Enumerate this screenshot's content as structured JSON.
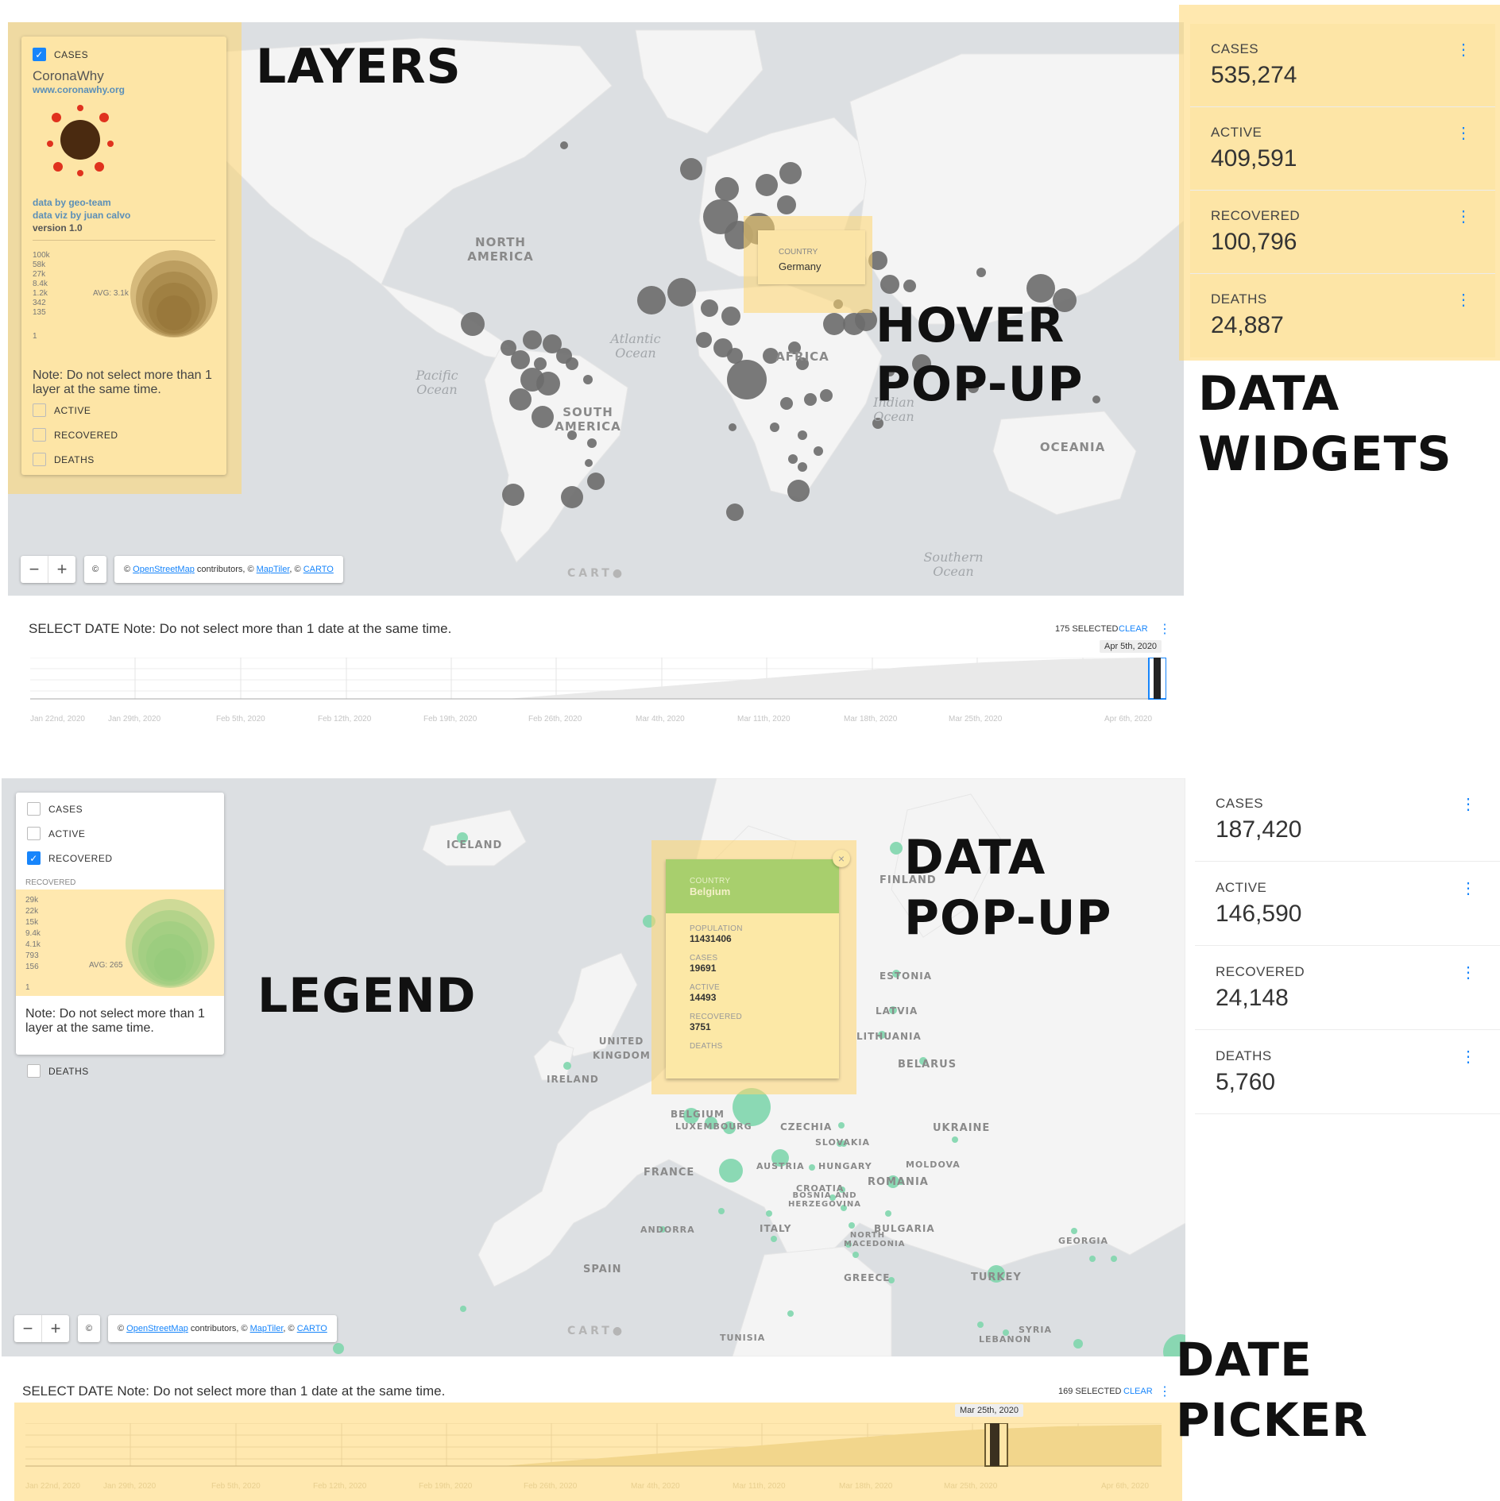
{
  "annotations": {
    "layers": "LAYERS",
    "hover_popup": [
      "HOVER",
      "POP-UP"
    ],
    "data_widgets": [
      "DATA",
      "WIDGETS"
    ],
    "data_popup": [
      "DATA",
      "POP-UP"
    ],
    "legend": "LEGEND",
    "date_picker": "DATE PICKER"
  },
  "top": {
    "layers": {
      "cases_label": "CASES",
      "brand": "CoronaWhy",
      "url": "www.coronawhy.org",
      "credit1": "data by geo-team",
      "credit2": "data viz by juan calvo",
      "version": "version 1.0",
      "legend_scale": [
        "100k",
        "58k",
        "27k",
        "8.4k",
        "1.2k",
        "342",
        "135",
        "1"
      ],
      "legend_avg": "AVG: 3.1k",
      "note": "Note: Do not select more than 1 layer at the same time.",
      "active_label": "ACTIVE",
      "recovered_label": "RECOVERED",
      "deaths_label": "DEATHS"
    },
    "hover_popup": {
      "label": "COUNTRY",
      "value": "Germany"
    },
    "map_labels": {
      "north_america": "NORTH AMERICA",
      "south_america": "SOUTH AMERICA",
      "africa": "AFRICA",
      "oceania": "OCEANIA",
      "atlantic": "Atlantic Ocean",
      "pacific": "Pacific Ocean",
      "indian": "Indian Ocean",
      "southern": "Southern Ocean"
    },
    "widgets": [
      {
        "label": "CASES",
        "value": "535,274"
      },
      {
        "label": "ACTIVE",
        "value": "409,591"
      },
      {
        "label": "RECOVERED",
        "value": "100,796"
      },
      {
        "label": "DEATHS",
        "value": "24,887"
      }
    ],
    "date": {
      "title": "SELECT DATE Note: Do not select more than 1 date at the same time.",
      "selected": "175 SELECTED",
      "clear": "CLEAR",
      "tooltip": "Apr 5th, 2020",
      "ticks": [
        "Jan 22nd, 2020",
        "Jan 29th, 2020",
        "Feb 5th, 2020",
        "Feb 12th, 2020",
        "Feb 19th, 2020",
        "Feb 26th, 2020",
        "Mar 4th, 2020",
        "Mar 11th, 2020",
        "Mar 18th, 2020",
        "Mar 25th, 2020",
        "Apr 6th, 2020"
      ]
    },
    "zoom": {
      "minus": "−",
      "plus": "+"
    },
    "attribution": {
      "copy": "©",
      "osm": "OpenStreetMap",
      "mid": " contributors, © ",
      "maptiler": "MapTiler",
      "carto": "CARTO"
    },
    "carto_logo": "CART"
  },
  "bottom": {
    "layers": {
      "cases_label": "CASES",
      "active_label": "ACTIVE",
      "recovered_label": "RECOVERED",
      "legend_title": "RECOVERED",
      "legend_scale": [
        "29k",
        "22k",
        "15k",
        "9.4k",
        "4.1k",
        "793",
        "156",
        "1"
      ],
      "legend_avg": "AVG: 265",
      "note": "Note: Do not select more than 1 layer at the same time.",
      "deaths_label": "DEATHS"
    },
    "popup": {
      "country_label": "COUNTRY",
      "country": "Belgium",
      "population_label": "POPULATION",
      "population": "11431406",
      "cases_label": "CASES",
      "cases": "19691",
      "active_label": "ACTIVE",
      "active": "14493",
      "recovered_label": "RECOVERED",
      "recovered": "3751",
      "deaths_label": "DEATHS"
    },
    "map_labels": {
      "iceland": "ICELAND",
      "finland": "FINLAND",
      "estonia": "ESTONIA",
      "latvia": "LATVIA",
      "lithuania": "LITHUANIA",
      "belarus": "BELARUS",
      "uk": "UNITED KINGDOM",
      "ireland": "IRELAND",
      "belgium": "BELGIUM",
      "luxembourg": "LUXEMBOURG",
      "czechia": "CZECHIA",
      "slovakia": "SLOVAKIA",
      "ukraine": "UKRAINE",
      "moldova": "MOLDOVA",
      "france": "FRANCE",
      "austria": "AUSTRIA",
      "hungary": "HUNGARY",
      "romania": "ROMANIA",
      "croatia": "CROATIA",
      "bosnia": "BOSNIA AND HERZEGOVINA",
      "andorra": "ANDORRA",
      "italy": "ITALY",
      "bulgaria": "BULGARIA",
      "north_macedonia": "NORTH MACEDONIA",
      "georgia": "GEORGIA",
      "spain": "SPAIN",
      "greece": "GREECE",
      "turkey": "TURKEY",
      "tunisia": "TUNISIA",
      "syria": "SYRIA",
      "lebanon": "LEBANON"
    },
    "widgets": [
      {
        "label": "CASES",
        "value": "187,420"
      },
      {
        "label": "ACTIVE",
        "value": "146,590"
      },
      {
        "label": "RECOVERED",
        "value": "24,148"
      },
      {
        "label": "DEATHS",
        "value": "5,760"
      }
    ],
    "date": {
      "title": "SELECT DATE Note: Do not select more than 1 date at the same time.",
      "selected": "169 SELECTED",
      "clear": "CLEAR",
      "tooltip": "Mar 25th, 2020",
      "ticks": [
        "Jan 22nd, 2020",
        "Jan 29th, 2020",
        "Feb 5th, 2020",
        "Feb 12th, 2020",
        "Feb 19th, 2020",
        "Feb 26th, 2020",
        "Mar 4th, 2020",
        "Mar 11th, 2020",
        "Mar 18th, 2020",
        "Mar 25th, 2020",
        "Apr 6th, 2020"
      ]
    },
    "zoom": {
      "minus": "−",
      "plus": "+"
    },
    "attribution": {
      "copy": "©",
      "osm": "OpenStreetMap",
      "mid": " contributors, © ",
      "maptiler": "MapTiler",
      "carto": "CARTO"
    },
    "carto_logo": "CART"
  },
  "colors": {
    "accent": "#1785fb",
    "highlight": "#ffd66e",
    "case_bubble": "#6b6b6b",
    "recovered_bubble": "#7fd6ad",
    "popup_header": "#a8cf6d"
  }
}
